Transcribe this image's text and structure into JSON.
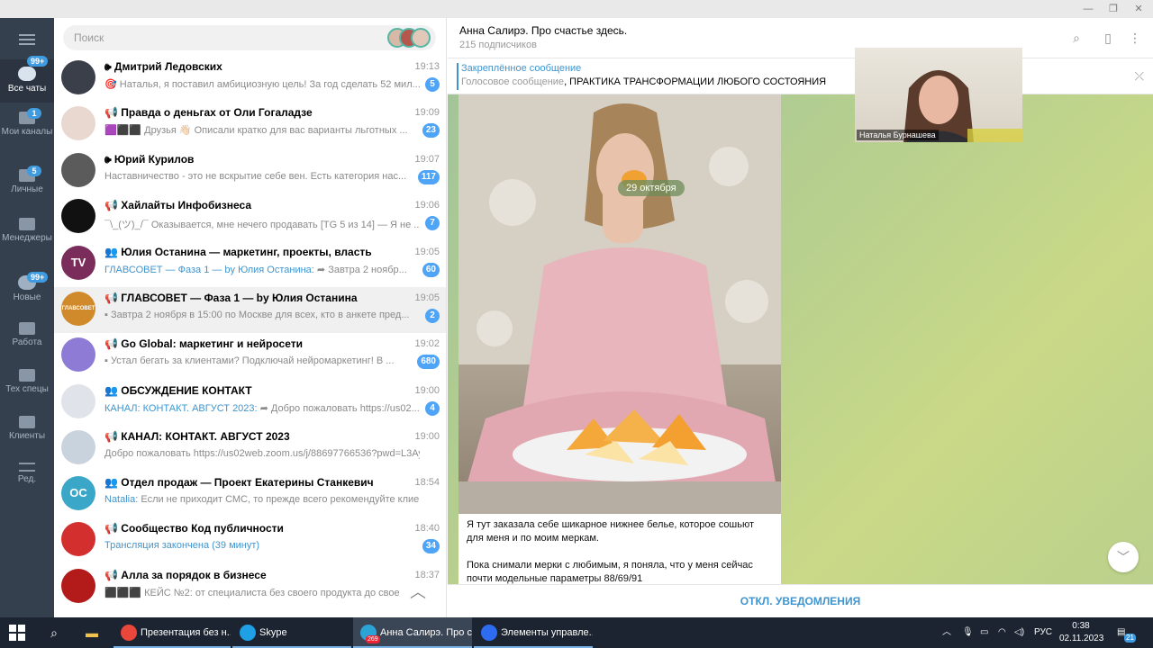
{
  "window_controls": {
    "minimize": "—",
    "restore": "❐",
    "close": "✕"
  },
  "folders": [
    {
      "label": "Все чаты",
      "badge": "99+",
      "icon": "chat-bubble-icon"
    },
    {
      "label": "Мои каналы",
      "badge": "1",
      "icon": "folder-icon"
    },
    {
      "label": "Личные",
      "badge": "5",
      "icon": "folder-icon"
    },
    {
      "label": "Менеджеры",
      "badge": "",
      "icon": "folder-icon"
    },
    {
      "label": "Новые",
      "badge": "99+",
      "icon": "chat-bubble-icon"
    },
    {
      "label": "Работа",
      "badge": "",
      "icon": "folder-icon"
    },
    {
      "label": "Тех спецы",
      "badge": "",
      "icon": "folder-icon"
    },
    {
      "label": "Клиенты",
      "badge": "",
      "icon": "folder-icon"
    },
    {
      "label": "Ред.",
      "badge": "",
      "icon": "sliders-icon"
    }
  ],
  "search": {
    "placeholder": "Поиск"
  },
  "chats": [
    {
      "name": "🕪 Дмитрий Ледовских",
      "time": "19:13",
      "preview": "🎯 Наталья, я поставил амбициозную цель! За год сделать 52 мил...",
      "badge": "5",
      "avatar_color": "#3a3f4a",
      "initials": ""
    },
    {
      "name": "📢 Правда о деньгах от Оли Гогаладзе",
      "time": "19:09",
      "preview": "🟪⬛⬛ Друзья 👋🏻 Описали кратко для вас варианты льготных ...",
      "badge": "23",
      "avatar_color": "#e8d8cf",
      "initials": ""
    },
    {
      "name": "🕪 Юрий Курилов",
      "time": "19:07",
      "preview": "Наставничество - это не вскрытие себе вен.  Есть категория нас...",
      "badge": "117",
      "avatar_color": "#5b5b5b",
      "initials": ""
    },
    {
      "name": "📢 Хайлайты Инфобизнеса",
      "time": "19:06",
      "preview": "¯\\_(ツ)_/¯ Оказывается, мне нечего продавать  [TG 5 из 14]  — Я не ...",
      "badge": "7",
      "avatar_color": "#111111",
      "initials": ""
    },
    {
      "name": "👥 Юлия Останина — маркетинг, проекты, власть",
      "time": "19:05",
      "preview_hl": "ГЛАВСОВЕТ — Фаза 1 — by Юлия Останина:",
      "preview": " ➦ Завтра 2 ноябр...",
      "badge": "60",
      "avatar_color": "#7a2d5a",
      "initials": "TV"
    },
    {
      "name": "📢 ГЛАВСОВЕТ — Фаза 1 — by Юлия Останина",
      "time": "19:05",
      "preview": "▪ Завтра 2 ноября в 15:00 по Москве для всех, кто в анкете пред...",
      "badge": "2",
      "avatar_color": "#d08a2c",
      "initials": "ГЛАВСОВЕТ"
    },
    {
      "name": "📢 Go Global: маркетинг и нейросети",
      "time": "19:02",
      "preview": "▪ Устал бегать за клиентами? Подключай нейромаркетинг!  В ...",
      "badge": "680",
      "avatar_color": "#8e7bd6",
      "initials": ""
    },
    {
      "name": "👥 ОБСУЖДЕНИЕ КОНТАКТ",
      "time": "19:00",
      "preview_hl": "КАНАЛ: КОНТАКТ. АВГУСТ 2023:",
      "preview": " ➦ Добро пожаловать https://us02...",
      "badge": "4",
      "avatar_color": "#e0e4ea",
      "initials": ""
    },
    {
      "name": "📢 КАНАЛ: КОНТАКТ. АВГУСТ 2023",
      "time": "19:00",
      "preview": "Добро пожаловать https://us02web.zoom.us/j/88697766536?pwd=L3Ay...",
      "badge": "",
      "avatar_color": "#c9d3de",
      "initials": ""
    },
    {
      "name": "👥 Отдел продаж — Проект Екатерины Станкевич",
      "time": "18:54",
      "preview_hl": "Natalia:",
      "preview": " Если не приходит СМС, то прежде всего рекомендуйте клиент...",
      "badge": "",
      "avatar_color": "#3aa7c9",
      "initials": "ОС"
    },
    {
      "name": "📢 Сообщество Код публичности",
      "time": "18:40",
      "preview_hl": "Трансляция закончена (39 минут)",
      "preview": "",
      "badge": "34",
      "avatar_color": "#d32f2f",
      "initials": ""
    },
    {
      "name": "📢 Алла за порядок в бизнесе",
      "time": "18:37",
      "preview": "⬛⬛⬛ КЕЙС №2: от специалиста без своего продукта до свое",
      "badge": "",
      "avatar_color": "#b31b1b",
      "initials": ""
    }
  ],
  "conversation": {
    "title": "Анна Салирэ. Про счастье здесь.",
    "subtitle": "215 подписчиков",
    "pinned_label": "Закреплённое сообщение",
    "pinned_prefix": "Голосовое сообщение",
    "pinned_text": ", ПРАКТИКА ТРАНСФОРМАЦИИ ЛЮБОГО СОСТОЯНИЯ",
    "date_chip": "29 октября",
    "message_p1": "Я тут заказала себе шикарное нижнее белье, которое сошьют для меня и по моим меркам.",
    "message_p2": "Пока снимали мерки с любимым, я поняла, что у меня сейчас почти модельные параметры 88/69/91",
    "mute_button": "ОТКЛ. УВЕДОМЛЕНИЯ"
  },
  "zoom_overlay": {
    "participant": "Наталья Бурнашева"
  },
  "taskbar": {
    "apps": [
      {
        "label": "Презентация без н...",
        "color": "#e9473b"
      },
      {
        "label": "Skype",
        "color": "#1fa0e5"
      },
      {
        "label": "Анна Салирэ. Про с...",
        "color": "#2aa3d6",
        "badge": "269"
      },
      {
        "label": "Элементы управле...",
        "color": "#2d6cf0"
      }
    ],
    "lang": "РУС",
    "time": "0:38",
    "date": "02.11.2023",
    "notif_count": "21"
  }
}
